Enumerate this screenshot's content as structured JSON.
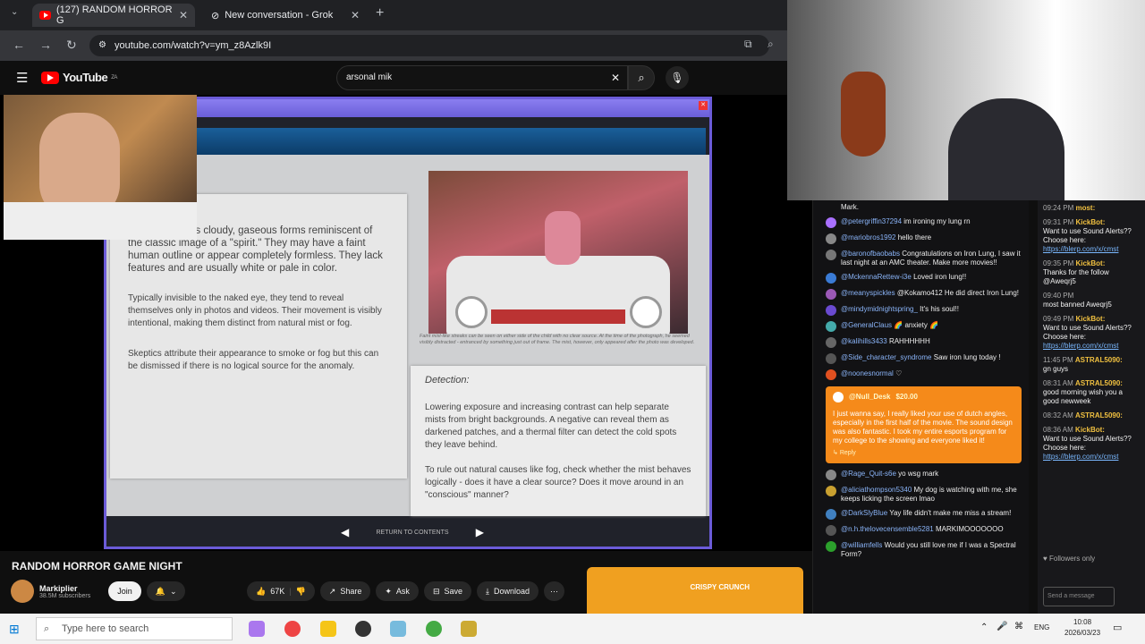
{
  "browser": {
    "tabs": [
      {
        "label": "(127) RANDOM HORROR G",
        "active": true
      },
      {
        "label": "New conversation - Grok",
        "active": false
      }
    ],
    "url": "youtube.com/watch?v=ym_z8Azlk9I"
  },
  "youtube": {
    "logo_text": "YouTube",
    "region": "ZA",
    "search_value": "arsonal mik"
  },
  "game": {
    "left_paragraphs": [
      "Mists appear as cloudy, gaseous forms reminiscent of the classic image of a \"spirit.\" They may have a faint human outline or appear completely formless. They lack features and are usually white or pale in color.",
      "Typically invisible to the naked eye, they tend to reveal themselves only in photos and videos. Their movement is visibly intentional, making them distinct from natural mist or fog.",
      "Skeptics attribute their appearance to smoke or fog but this can be dismissed if there is no logical source for the anomaly."
    ],
    "photo_caption": "Faint mist-like streaks can be seen on either side of the child with no clear source. At the time of the photograph, he seemed visibly distracted - entranced by something just out of frame. The mist, however, only appeared after the photo was developed.",
    "detection_title": "Detection:",
    "detection_paragraphs": [
      "Lowering exposure and increasing contrast can help separate mists from bright backgrounds. A negative can reveal them as darkened patches, and a thermal filter can detect the cold spots they leave behind.",
      "To rule out natural causes like fog, check whether the mist behaves logically - does it have a clear source? Does it move around in an \"conscious\" manner?"
    ],
    "nav_label": "RETURN TO CONTENTS"
  },
  "chat": {
    "top_partial": "Mark.",
    "messages": [
      {
        "user": "@petergriffin37294",
        "text": "im ironing my lung rn",
        "color": "#a970ff"
      },
      {
        "user": "@mariobros1992",
        "text": "hello there",
        "color": "#888888"
      },
      {
        "user": "@baronofbaobabs",
        "text": "Congratulations on Iron Lung, I saw it last night at an AMC theater. Make more movies!!",
        "color": "#777777"
      },
      {
        "user": "@MckennaRettew-i3e",
        "text": "Loved iron lung!!",
        "color": "#3a7bd5"
      },
      {
        "user": "@meanyspickles",
        "text": "@Kokamo412 He did direct Iron Lung!",
        "color": "#9b59b6"
      },
      {
        "user": "@mindymidnightspring_",
        "text": "It's his soul!!",
        "color": "#6a4ad0"
      },
      {
        "user": "@GeneralClaus",
        "text": "🌈 anxiety 🌈",
        "color": "#4aa"
      },
      {
        "user": "@kalihills3433",
        "text": "RAHHHHHH",
        "color": "#666666"
      },
      {
        "user": "@Side_character_syndrome",
        "text": "Saw iron lung today !",
        "color": "#555555"
      },
      {
        "user": "@noonesnormal",
        "text": "♡",
        "color": "#e05020"
      }
    ],
    "donation": {
      "user": "@Null_Desk",
      "amount": "$20.00",
      "text": "I just wanna say, I really liked your use of dutch angles, especially in the first half of the movie. The sound design was also fantastic. I took my entire esports program for my college to the showing and everyone liked it!",
      "reply": "Reply"
    },
    "messages_after": [
      {
        "user": "@Rage_Quit-s6e",
        "text": "yo wsg mark",
        "color": "#888888"
      },
      {
        "user": "@aliciathompson5340",
        "text": "My dog is watching with me, she keeps licking the screen lmao",
        "color": "#c9a030"
      },
      {
        "user": "@DarkSlyBlue",
        "text": "Yay life didn't make me miss a stream!",
        "color": "#4080c0"
      },
      {
        "user": "@n.h.thelovecensemble5281",
        "text": "MARKIMOOOOOOO",
        "color": "#555555"
      },
      {
        "user": "@williamfells",
        "text": "Would you still love me if I was a Spectral Form?",
        "color": "#2ca02c"
      }
    ]
  },
  "chat2": {
    "messages": [
      {
        "time": "09:24 PM",
        "user": "most:",
        "text": ""
      },
      {
        "time": "09:31 PM",
        "user": "KickBot:",
        "text": "Want to use Sound Alerts?? Choose here:",
        "link": "https://blerp.com/x/cmst"
      },
      {
        "time": "09:35 PM",
        "user": "KickBot:",
        "text": "Thanks for the follow @Aweqrj5",
        "link": ""
      },
      {
        "time": "09:40 PM",
        "user": "",
        "text": "most banned Aweqrj5",
        "link": ""
      },
      {
        "time": "09:49 PM",
        "user": "KickBot:",
        "text": "Want to use Sound Alerts?? Choose here:",
        "link": "https://blerp.com/x/cmst"
      },
      {
        "time": "11:45 PM",
        "user": "ASTRAL5090:",
        "text": "gn guys",
        "link": ""
      },
      {
        "time": "08:31 AM",
        "user": "ASTRAL5090:",
        "text": "good morning wish you a good newweek",
        "link": ""
      },
      {
        "time": "08:32 AM",
        "user": "ASTRAL5090:",
        "text": "",
        "link": ""
      },
      {
        "time": "08:36 AM",
        "user": "KickBot:",
        "text": "Want to use Sound Alerts?? Choose here:",
        "link": "https://blerp.com/x/cmst"
      }
    ],
    "followers_only": "Followers only",
    "send_placeholder": "Send a message"
  },
  "video": {
    "title": "RANDOM HORROR GAME NIGHT",
    "channel": "Markiplier",
    "subscribers": "38.5M subscribers",
    "join_label": "Join",
    "likes": "67K",
    "share_label": "Share",
    "ask_label": "Ask",
    "save_label": "Save",
    "download_label": "Download",
    "ad_brand": "CRISPY CRUNCH"
  },
  "taskbar": {
    "search_placeholder": "Type here to search",
    "lang": "ENG",
    "time": "10:08",
    "date": "2026/03/23"
  }
}
